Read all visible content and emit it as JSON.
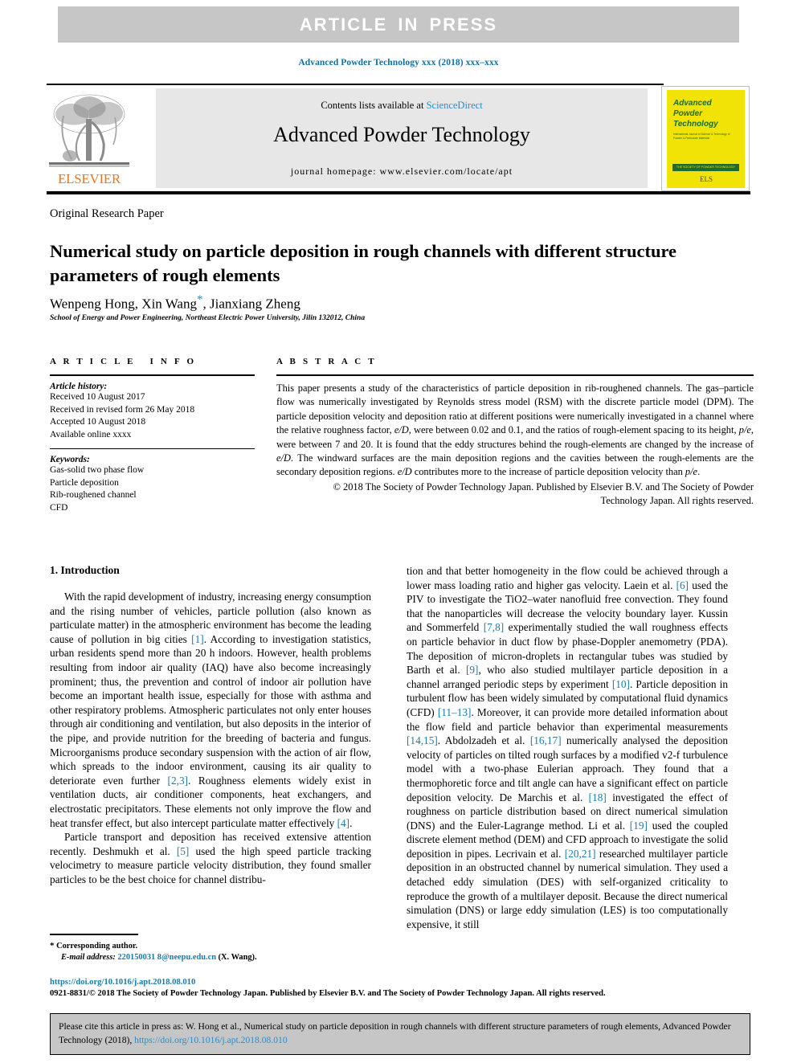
{
  "banner": {
    "text": "ARTICLE  IN  PRESS",
    "bg": "#c6c6c6",
    "fg": "#ffffff"
  },
  "journal_ref": "Advanced Powder Technology xxx (2018) xxx–xxx",
  "masthead": {
    "contents_prefix": "Contents lists available at ",
    "sciencedirect": "ScienceDirect",
    "journal_title": "Advanced Powder Technology",
    "homepage": "journal homepage: www.elsevier.com/locate/apt",
    "publisher": "ELSEVIER",
    "cover": {
      "title": "Advanced\nPowder\nTechnology",
      "subtitle": "International Journal of Science & Technology of Powder & Particulate Materials",
      "bar": "THE SOCIETY OF POWDER TECHNOLOGY JAPAN",
      "logo": "ELS",
      "bg": "#f2e307",
      "fg": "#1d6b2e"
    }
  },
  "article": {
    "kicker": "Original Research Paper",
    "title": "Numerical study on particle deposition in rough channels with different structure parameters of rough elements",
    "authors_pre": "Wenpeng Hong, Xin Wang",
    "authors_star": "*",
    "authors_post": ", Jianxiang Zheng",
    "affiliation": "School of Energy and Power Engineering, Northeast Electric Power University, Jilin 132012, China"
  },
  "article_info": {
    "heading": "ARTICLE INFO",
    "history_label": "Article history:",
    "history": [
      "Received 10 August 2017",
      "Received in revised form 26 May 2018",
      "Accepted 10 August 2018",
      "Available online xxxx"
    ],
    "keywords_label": "Keywords:",
    "keywords": [
      "Gas-solid two phase flow",
      "Particle deposition",
      "Rib-roughened channel",
      "CFD"
    ]
  },
  "abstract": {
    "heading": "ABSTRACT",
    "body_p1": "This paper presents a study of the characteristics of particle deposition in rib-roughened channels. The gas–particle flow was numerically investigated by Reynolds stress model (RSM) with the discrete particle model (DPM). The particle deposition velocity and deposition ratio at different positions were numerically investigated in a channel where the relative roughness factor, ",
    "var1": "e/D",
    "body_p2": ", were between 0.02 and 0.1, and the ratios of rough-element spacing to its height, ",
    "var2": "p/e",
    "body_p3": ", were between 7 and 20. It is found that the eddy structures behind the rough-elements are changed by the increase of ",
    "var3": "e/D",
    "body_p4": ". The windward surfaces are the main deposition regions and the cavities between the rough-elements are the secondary deposition regions. ",
    "var4": "e/D",
    "body_p5": " contributes more to the increase of particle deposition velocity than ",
    "var5": "p/e",
    "body_p6": ".",
    "copyright_line1": "© 2018 The Society of Powder Technology Japan. Published by Elsevier B.V. and The Society of Powder",
    "copyright_line2": "Technology Japan. All rights reserved."
  },
  "intro": {
    "heading": "1. Introduction",
    "left_p1_a": "With the rapid development of industry, increasing energy consumption and the rising number of vehicles, particle pollution (also known as particulate matter) in the atmospheric environment has become the leading cause of pollution in big cities ",
    "left_p1_r1": "[1]",
    "left_p1_b": ". According to investigation statistics, urban residents spend more than 20 h indoors. However, health problems resulting from indoor air quality (IAQ) have also become increasingly prominent; thus, the prevention and control of indoor air pollution have become an important health issue, especially for those with asthma and other respiratory problems. Atmospheric particulates not only enter houses through air conditioning and ventilation, but also deposits in the interior of the pipe, and provide nutrition for the breeding of bacteria and fungus. Microorganisms produce secondary suspension with the action of air flow, which spreads to the indoor environment, causing its air quality to deteriorate even further ",
    "left_p1_r2": "[2,3]",
    "left_p1_c": ". Roughness elements widely exist in ventilation ducts, air conditioner components, heat exchangers, and electrostatic precipitators. These elements not only improve the flow and heat transfer effect, but also intercept particulate matter effectively ",
    "left_p1_r3": "[4]",
    "left_p1_d": ".",
    "left_p2_a": "Particle transport and deposition has received extensive attention recently. Deshmukh et al. ",
    "left_p2_r1": "[5]",
    "left_p2_b": " used the high speed particle tracking velocimetry to measure particle velocity distribution, they found smaller particles to be the best choice for channel distribu-",
    "right_a": "tion and that better homogeneity in the flow could be achieved through a lower mass loading ratio and higher gas velocity. Laein et al. ",
    "right_r1": "[6]",
    "right_b": " used the PIV to investigate the TiO2–water nanofluid free convection. They found that the nanoparticles will decrease the velocity boundary layer. Kussin and Sommerfeld ",
    "right_r2": "[7,8]",
    "right_c": " experimentally studied the wall roughness effects on particle behavior in duct flow by phase-Doppler anemometry (PDA). The deposition of micron-droplets in rectangular tubes was studied by Barth et al. ",
    "right_r3": "[9]",
    "right_d": ", who also studied multilayer particle deposition in a channel arranged periodic steps by experiment ",
    "right_r4": "[10]",
    "right_e": ". Particle deposition in turbulent flow has been widely simulated by computational fluid dynamics (CFD) ",
    "right_r5": "[11–13]",
    "right_f": ". Moreover, it can provide more detailed information about the flow field and particle behavior than experimental measurements ",
    "right_r6": "[14,15]",
    "right_g": ". Abdolzadeh et al. ",
    "right_r7": "[16,17]",
    "right_h": " numerically analysed the deposition velocity of particles on tilted rough surfaces by a modified v2-f turbulence model with a two-phase Eulerian approach. They found that a thermophoretic force and tilt angle can have a significant effect on particle deposition velocity. De Marchis et al. ",
    "right_r8": "[18]",
    "right_i": " investigated the effect of roughness on particle distribution based on direct numerical simulation (DNS) and the Euler-Lagrange method. Li et al. ",
    "right_r9": "[19]",
    "right_j": " used the coupled discrete element method (DEM) and CFD approach to investigate the solid deposition in pipes. Lecrivain et al. ",
    "right_r10": "[20,21]",
    "right_k": " researched multilayer particle deposition in an obstructed channel by numerical simulation. They used a detached eddy simulation (DES) with self-organized criticality to reproduce the growth of a multilayer deposit. Because the direct numerical simulation (DNS) or large eddy simulation (LES) is too computationally expensive, it still"
  },
  "footnote": {
    "symbol": "*",
    "corresponding": " Corresponding author.",
    "email_label": "E-mail address:",
    "email": "220150031 8@neepu.edu.cn",
    "email_suffix": " (X. Wang)."
  },
  "bottom": {
    "doi": "https://doi.org/10.1016/j.apt.2018.08.010",
    "issn_line": "0921-8831/© 2018 The Society of Powder Technology Japan. Published by Elsevier B.V. and The Society of Powder Technology Japan. All rights reserved."
  },
  "cite_box": {
    "text_a": "Please cite this article in press as: W. Hong et al., Numerical study on particle deposition in rough channels with different structure parameters of rough elements, Advanced Powder Technology (2018), ",
    "link": "https://doi.org/10.1016/j.apt.2018.08.010"
  }
}
